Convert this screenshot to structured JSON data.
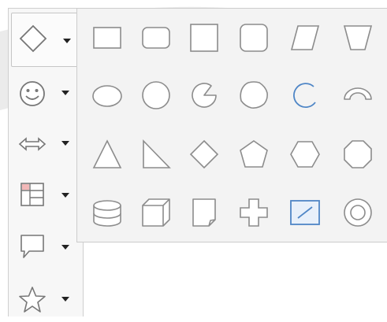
{
  "sidebar": {
    "items": [
      {
        "name": "basic-shapes",
        "icon": "diamond-icon",
        "active": true
      },
      {
        "name": "symbol-shapes",
        "icon": "smiley-icon",
        "active": false
      },
      {
        "name": "block-arrows",
        "icon": "double-arrow-icon",
        "active": false
      },
      {
        "name": "flowchart",
        "icon": "flowchart-icon",
        "active": false
      },
      {
        "name": "callouts",
        "icon": "callout-icon",
        "active": false
      },
      {
        "name": "stars",
        "icon": "star-icon",
        "active": false
      }
    ]
  },
  "popup": {
    "rows": [
      [
        "rectangle-icon",
        "rounded-rectangle-icon",
        "square-icon",
        "rounded-square-icon",
        "parallelogram-icon",
        "trapezoid-icon"
      ],
      [
        "ellipse-icon",
        "circle-icon",
        "circle-pie-icon",
        "octagon-rounded-icon",
        "arc-icon",
        "block-arc-icon"
      ],
      [
        "isosceles-triangle-icon",
        "right-triangle-icon",
        "diamond-icon",
        "pentagon-icon",
        "hexagon-icon",
        "octagon-icon"
      ],
      [
        "cylinder-icon",
        "cube-icon",
        "folded-corner-icon",
        "cross-icon",
        "frame-icon",
        "ring-icon"
      ]
    ],
    "highlighted": [
      "arc-icon",
      "frame-icon"
    ]
  },
  "colors": {
    "stroke": "#8c8c8c",
    "fill": "#ffffff",
    "accent": "#4f86c6",
    "accent_fill": "#e8f0fa"
  }
}
